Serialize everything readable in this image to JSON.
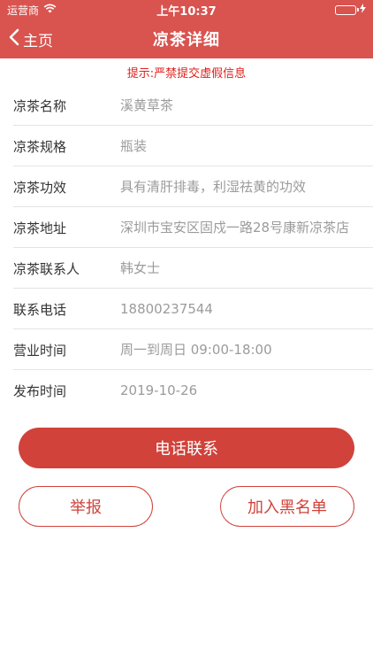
{
  "status_bar": {
    "carrier": "运营商",
    "time": "上午10:37",
    "icons": [
      "wifi-icon",
      "battery-icon",
      "charging-icon"
    ]
  },
  "nav": {
    "back_label": "主页",
    "title": "凉茶详细"
  },
  "warning": "提示:严禁提交虚假信息",
  "info": [
    {
      "label": "凉茶名称",
      "value": "溪黄草茶"
    },
    {
      "label": "凉茶规格",
      "value": "瓶装"
    },
    {
      "label": "凉茶功效",
      "value": "具有清肝排毒，利湿祛黄的功效"
    },
    {
      "label": "凉茶地址",
      "value": "深圳市宝安区固戍一路28号康新凉茶店"
    },
    {
      "label": "凉茶联系人",
      "value": "韩女士"
    },
    {
      "label": "联系电话",
      "value": "18800237544"
    },
    {
      "label": "营业时间",
      "value": "周一到周日 09:00-18:00"
    },
    {
      "label": "发布时间",
      "value": "2019-10-26"
    }
  ],
  "actions": {
    "call": "电话联系",
    "report": "举报",
    "blacklist": "加入黑名单"
  },
  "colors": {
    "primary": "#d9534f",
    "button": "#d0423a",
    "warning": "#e0201b",
    "label": "#333333",
    "value": "#9b9b9b"
  }
}
